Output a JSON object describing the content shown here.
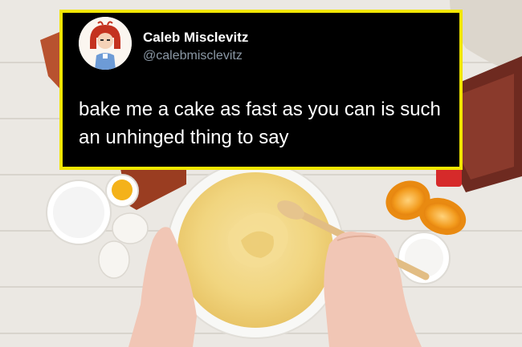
{
  "tweet": {
    "author_name": "Caleb Misclevitz",
    "handle": "@calebmisclevitz",
    "text": "bake me a cake as fast as you can is such an unhinged thing to say",
    "border_color": "#f2e600"
  },
  "photo": {
    "description_icons": [
      "mixing-bowl-icon",
      "whisk-spoon-icon",
      "egg-icon",
      "orange-slice-icon",
      "flour-bowl-icon",
      "baking-pan-icon"
    ]
  }
}
